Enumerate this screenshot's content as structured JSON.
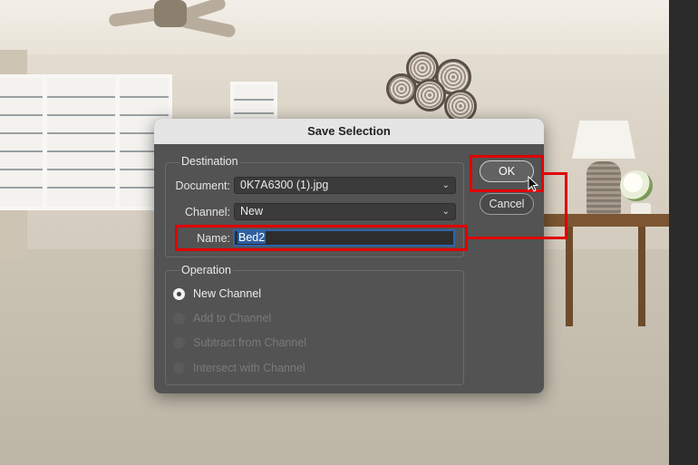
{
  "dialog": {
    "title": "Save Selection",
    "destination": {
      "legend": "Destination",
      "document_label": "Document:",
      "document_value": "0K7A6300 (1).jpg",
      "channel_label": "Channel:",
      "channel_value": "New",
      "name_label": "Name:",
      "name_value": "Bed2"
    },
    "operation": {
      "legend": "Operation",
      "options": [
        {
          "label": "New Channel",
          "selected": true,
          "enabled": true
        },
        {
          "label": "Add to Channel",
          "selected": false,
          "enabled": false
        },
        {
          "label": "Subtract from Channel",
          "selected": false,
          "enabled": false
        },
        {
          "label": "Intersect with Channel",
          "selected": false,
          "enabled": false
        }
      ]
    },
    "buttons": {
      "ok": "OK",
      "cancel": "Cancel"
    }
  },
  "icons": {
    "dropdown": "chevron-down-icon",
    "cursor": "mouse-pointer-icon"
  },
  "colors": {
    "annotation": "#e00000",
    "field_focus": "#2f63ad"
  }
}
